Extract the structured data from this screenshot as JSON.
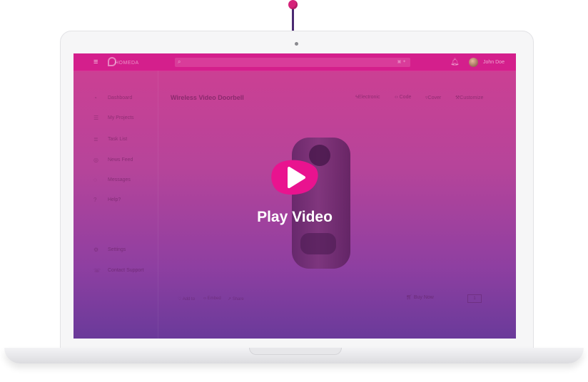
{
  "app": {
    "logo_text": "HOMEDA",
    "user_name": "John Doe"
  },
  "sidebar": {
    "items": [
      {
        "label": "Dashboard",
        "icon": "dashboard-icon"
      },
      {
        "label": "My Projects",
        "icon": "projects-icon"
      },
      {
        "label": "Task List",
        "icon": "list-icon"
      },
      {
        "label": "News Feed",
        "icon": "news-icon"
      },
      {
        "label": "Messages",
        "icon": "chat-icon"
      },
      {
        "label": "Help?",
        "icon": "help-icon"
      },
      {
        "label": "Settings",
        "icon": "gear-icon"
      },
      {
        "label": "Contact Support",
        "icon": "support-icon"
      }
    ]
  },
  "product": {
    "title": "Wireless Video Doorbell",
    "tabs": [
      {
        "label": "Electronic",
        "icon": "bolt-icon"
      },
      {
        "label": "Code",
        "icon": "code-icon"
      },
      {
        "label": "Cover",
        "icon": "shield-icon"
      },
      {
        "label": "Customize",
        "icon": "wrench-icon"
      }
    ],
    "bottom_links": [
      "Add to",
      "Embed",
      "Share"
    ],
    "buy_label": "Buy Now",
    "qty": "1"
  },
  "overlay": {
    "play_label": "Play Video",
    "accent": "#e9138f"
  },
  "colors": {
    "screen_top": "#cf3f92",
    "screen_bottom": "#6a3a9a",
    "topbar": "#d41f8c",
    "pin": "#d6237a"
  }
}
